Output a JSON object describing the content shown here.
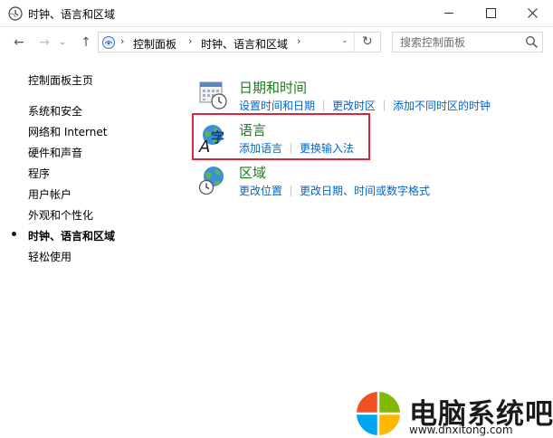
{
  "window": {
    "title": "时钟、语言和区域",
    "icon": "clock-globe-icon",
    "controls": [
      "minimize-icon",
      "maximize-icon",
      "close-icon"
    ]
  },
  "nav": {
    "back_icon": "arrow-left-icon",
    "forward_icon": "arrow-right-icon",
    "recent_icon": "chevron-down-icon",
    "up_icon": "arrow-up-icon",
    "back": "←",
    "forward": "→",
    "recent": "⌄",
    "up": "↑"
  },
  "address": {
    "separator": "›",
    "crumbs": [
      "控制面板",
      "时钟、语言和区域"
    ],
    "dropdown": "⌄",
    "refresh": "↻"
  },
  "search": {
    "placeholder": "搜索控制面板",
    "value": ""
  },
  "sidebar": {
    "home": "控制面板主页",
    "items": [
      {
        "label": "系统和安全",
        "current": false
      },
      {
        "label": "网络和 Internet",
        "current": false
      },
      {
        "label": "硬件和声音",
        "current": false
      },
      {
        "label": "程序",
        "current": false
      },
      {
        "label": "用户帐户",
        "current": false
      },
      {
        "label": "外观和个性化",
        "current": false
      },
      {
        "label": "时钟、语言和区域",
        "current": true
      },
      {
        "label": "轻松使用",
        "current": false
      }
    ]
  },
  "categories": [
    {
      "title": "日期和时间",
      "icon": "calendar-clock-icon",
      "links": [
        "设置时间和日期",
        "更改时区",
        "添加不同时区的时钟"
      ]
    },
    {
      "title": "语言",
      "icon": "language-icon",
      "links": [
        "添加语言",
        "更换输入法"
      ]
    },
    {
      "title": "区域",
      "icon": "globe-clock-icon",
      "links": [
        "更改位置",
        "更改日期、时间或数字格式"
      ]
    }
  ],
  "watermark": {
    "text": "电脑系统吧",
    "url": "www.dnxitong.com"
  },
  "colors": {
    "category_title": "#1e7b1e",
    "link": "#0066cc",
    "highlight": "#d7263d",
    "logo_red": "#f25022",
    "logo_green": "#7fba00",
    "logo_blue": "#00a4ef",
    "logo_yellow": "#ffb900"
  }
}
